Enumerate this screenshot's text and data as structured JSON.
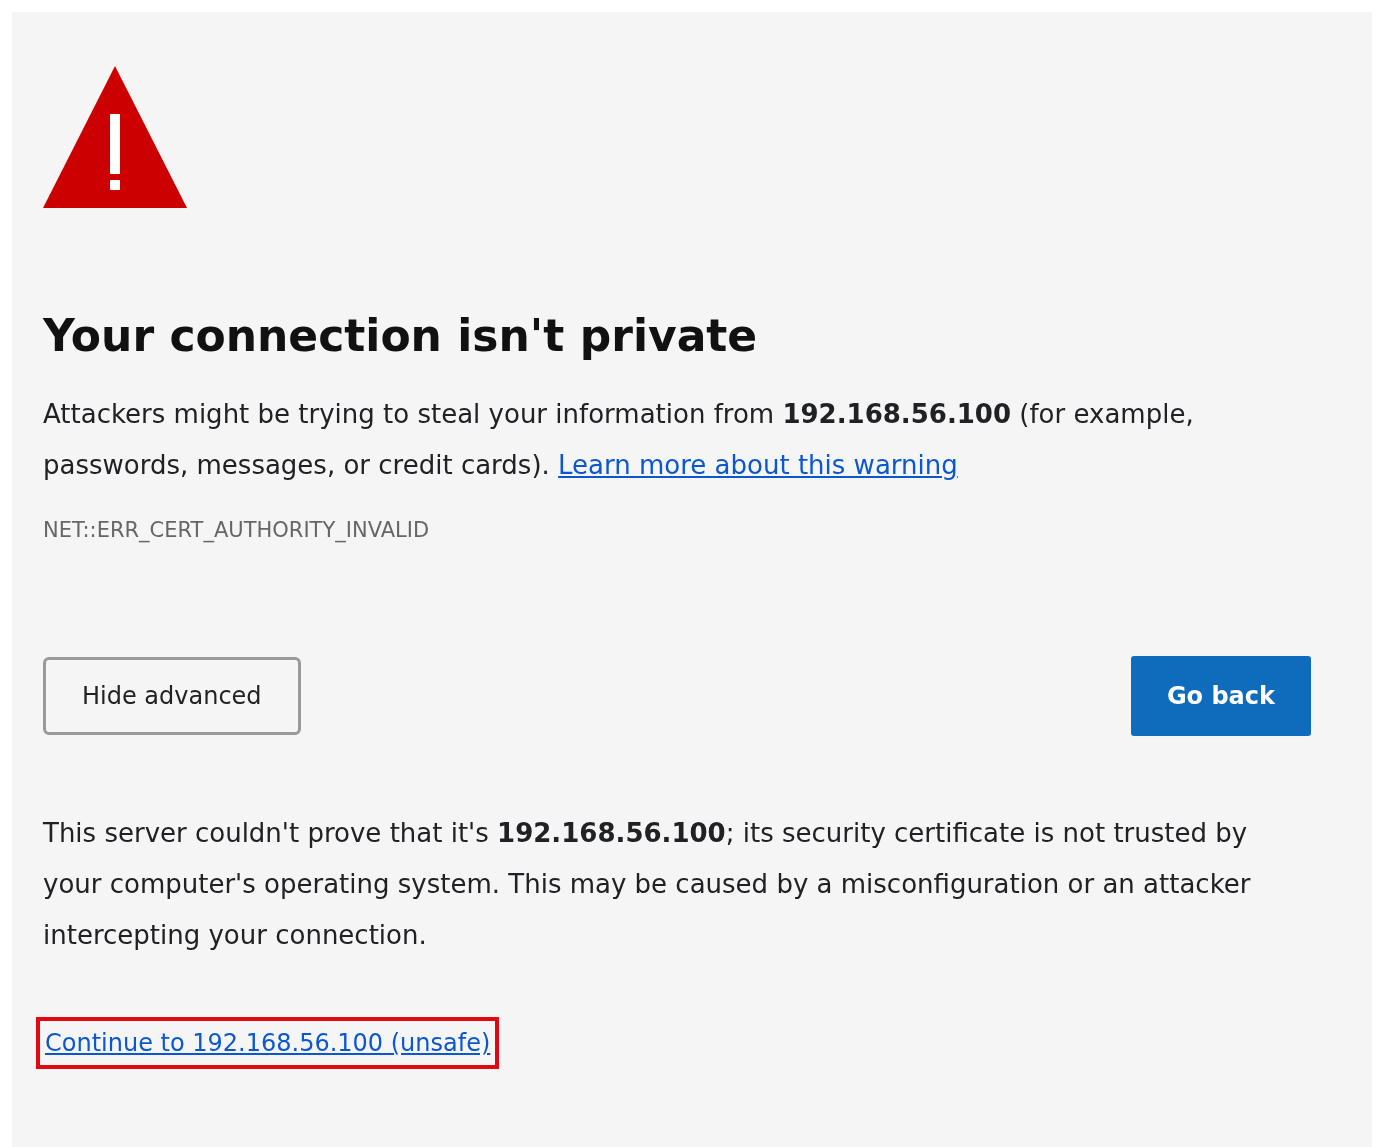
{
  "heading": "Your connection isn't private",
  "intro": {
    "text": "Attackers might be trying to steal your information from **192.168.56.100** (for example, passwords, messages, or credit cards).",
    "link": "Learn more about this warning"
  },
  "error_code": "NET::ERR_CERT_AUTHORITY_INVALID",
  "buttons": [
    {
      "label": "Hide advanced",
      "kind": "secondary"
    },
    {
      "label": "Go back",
      "kind": "primary"
    }
  ],
  "details": "This server couldn't prove that it's **192.168.56.100**; its security certificate is not trusted by your computer's operating system. This may be caused by a misconfiguration or an attacker intercepting your connection.",
  "proceed_link": {
    "label": "Continue to 192.168.56.100 (unsafe)",
    "highlighted": true
  }
}
